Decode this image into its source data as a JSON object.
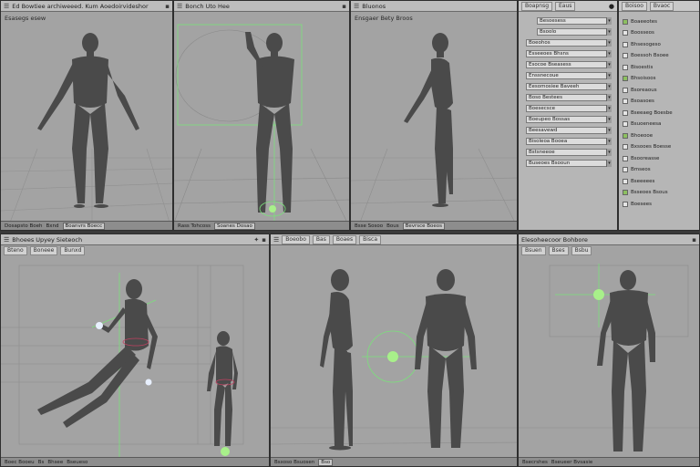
{
  "viewports": {
    "top_left": {
      "title": "Ed Bowtiee archiweeed. Kum Aoedoirvideshor",
      "subtitle": "Esasegs esew",
      "footer": [
        "Dosapsto Boeh",
        "Bxnd",
        "Boanvrs Boecc"
      ]
    },
    "top_mid": {
      "title": "Bonch Uto Hee",
      "subtitle": "",
      "footer": [
        "Rass Tohcoss",
        "Soanes Dosao"
      ]
    },
    "top_right": {
      "title": "Bluonos",
      "subtitle": "Ensgaer Bety Broos",
      "footer": [
        "Bsse Sosoo",
        "Bous",
        "Bevrsce Boeos"
      ]
    },
    "bottom_left": {
      "title": "Bhoees Upyey Sieteoch",
      "tabs": [
        "Bteno",
        "Boneee",
        "Bunxd"
      ],
      "footer": [
        "Boec Booeu",
        "Bs",
        "Bhsee",
        "Bseueso"
      ]
    },
    "bottom_mid": {
      "tabs": [
        "Boeobo",
        "Bas",
        "Boaes",
        "Bisca"
      ],
      "footer": [
        "Bsxoso Bsuosen",
        "Bso"
      ]
    },
    "bottom_right": {
      "title": "Elesoheecoor Bohbore",
      "tabs": [
        "Bsuen",
        "Bses",
        "Bsbu"
      ],
      "footer": [
        "Bsecrshes",
        "Bseueer Bvsasie"
      ]
    }
  },
  "properties_main": {
    "tabs": [
      "Boapnsg",
      "Eaus"
    ],
    "rows": [
      "Besoesess",
      "Bsoolo",
      "Boeohos",
      "Esseeoes Bhsns",
      "Esocoe Bseasess",
      "Enssnecoue",
      "Eesomosiee Baveeh",
      "Boso Bestees",
      "Boesecsce",
      "Boeupeo Bossas",
      "Beesavewd",
      "Bisoleoa Booea",
      "Bstsneeoe",
      "Buseoes Bsooun"
    ]
  },
  "properties_side": {
    "tabs": [
      "Boisoo",
      "Bvaoc"
    ],
    "rows": [
      "Boaeeotes",
      "Boosseos",
      "Bhsesogeso",
      "Boessoh Bsoee",
      "Bisoestis",
      "Bhsoisoos",
      "Bsoreaous",
      "Bsoasoes",
      "Bseeaeg Boesbe",
      "Bsuoeneesa",
      "Bhoeooe",
      "Bxsooes Boesse",
      "Bsooreasse",
      "Bmseos",
      "Bseeeees",
      "Bsseoes Bsous",
      "Boesees"
    ]
  },
  "colors": {
    "panel": "#a3a3a3",
    "header": "#bdbdbd",
    "accent": "#7be07b",
    "figure": "#4c4c4c"
  }
}
